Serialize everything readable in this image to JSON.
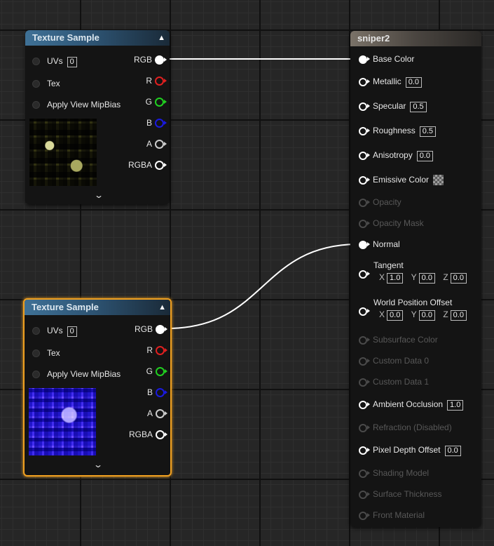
{
  "texture_nodes": [
    {
      "title": "Texture Sample",
      "selected": false,
      "inputs": [
        {
          "label": "UVs",
          "value": "0"
        },
        {
          "label": "Tex",
          "value": ""
        },
        {
          "label": "Apply View MipBias",
          "value": ""
        }
      ],
      "outputs": [
        {
          "label": "RGB",
          "color": "#ffffff",
          "connected": true
        },
        {
          "label": "R",
          "color": "#e02020",
          "connected": false
        },
        {
          "label": "G",
          "color": "#20d020",
          "connected": false
        },
        {
          "label": "B",
          "color": "#1a1ae0",
          "connected": false
        },
        {
          "label": "A",
          "color": "#cccccc",
          "connected": false
        },
        {
          "label": "RGBA",
          "color": "#ffffff",
          "connected": false
        }
      ]
    },
    {
      "title": "Texture Sample",
      "selected": true,
      "inputs": [
        {
          "label": "UVs",
          "value": "0"
        },
        {
          "label": "Tex",
          "value": ""
        },
        {
          "label": "Apply View MipBias",
          "value": ""
        }
      ],
      "outputs": [
        {
          "label": "RGB",
          "color": "#ffffff",
          "connected": true
        },
        {
          "label": "R",
          "color": "#e02020",
          "connected": false
        },
        {
          "label": "G",
          "color": "#20d020",
          "connected": false
        },
        {
          "label": "B",
          "color": "#1a1ae0",
          "connected": false
        },
        {
          "label": "A",
          "color": "#cccccc",
          "connected": false
        },
        {
          "label": "RGBA",
          "color": "#ffffff",
          "connected": false
        }
      ]
    }
  ],
  "material": {
    "title": "sniper2",
    "inputs": [
      {
        "label": "Base Color",
        "value": "",
        "enabled": true,
        "connected": true
      },
      {
        "label": "Metallic",
        "value": "0.0",
        "enabled": true,
        "connected": false
      },
      {
        "label": "Specular",
        "value": "0.5",
        "enabled": true,
        "connected": false
      },
      {
        "label": "Roughness",
        "value": "0.5",
        "enabled": true,
        "connected": false
      },
      {
        "label": "Anisotropy",
        "value": "0.0",
        "enabled": true,
        "connected": false
      },
      {
        "label": "Emissive Color",
        "value": "",
        "enabled": true,
        "connected": false
      },
      {
        "label": "Opacity",
        "value": "",
        "enabled": false,
        "connected": false
      },
      {
        "label": "Opacity Mask",
        "value": "",
        "enabled": false,
        "connected": false
      },
      {
        "label": "Normal",
        "value": "",
        "enabled": true,
        "connected": true
      },
      {
        "label": "Tangent",
        "value": "",
        "enabled": true,
        "connected": false
      },
      {
        "label": "World Position Offset",
        "value": "",
        "enabled": true,
        "connected": false
      },
      {
        "label": "Subsurface Color",
        "value": "",
        "enabled": false,
        "connected": false
      },
      {
        "label": "Custom Data 0",
        "value": "",
        "enabled": false,
        "connected": false
      },
      {
        "label": "Custom Data 1",
        "value": "",
        "enabled": false,
        "connected": false
      },
      {
        "label": "Ambient Occlusion",
        "value": "1.0",
        "enabled": true,
        "connected": false
      },
      {
        "label": "Refraction (Disabled)",
        "value": "",
        "enabled": false,
        "connected": false
      },
      {
        "label": "Pixel Depth Offset",
        "value": "0.0",
        "enabled": true,
        "connected": false
      },
      {
        "label": "Shading Model",
        "value": "",
        "enabled": false,
        "connected": false
      },
      {
        "label": "Surface Thickness",
        "value": "",
        "enabled": false,
        "connected": false
      },
      {
        "label": "Front Material",
        "value": "",
        "enabled": false,
        "connected": false
      }
    ],
    "tangent_xyz": {
      "x_label": "X",
      "x": "1.0",
      "y_label": "Y",
      "y": "0.0",
      "z_label": "Z",
      "z": "0.0"
    },
    "wpo_xyz": {
      "x_label": "X",
      "x": "0.0",
      "y_label": "Y",
      "y": "0.0",
      "z_label": "Z",
      "z": "0.0"
    }
  },
  "colors": {
    "selection": "#f0a020",
    "wire": "#ffffff",
    "texture_header": "#3f7196",
    "material_header": "#7a7268"
  },
  "icons": {
    "collapse": "chevron-up-icon",
    "expand": "chevron-down-icon",
    "checker": "checkerboard-swatch"
  }
}
